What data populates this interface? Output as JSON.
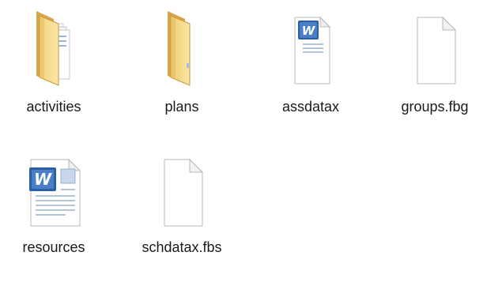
{
  "files": [
    {
      "name": "activities",
      "icon": "folder-with-documents-icon"
    },
    {
      "name": "plans",
      "icon": "folder-icon"
    },
    {
      "name": "assdatax",
      "icon": "word-document-icon"
    },
    {
      "name": "groups.fbg",
      "icon": "blank-file-icon"
    },
    {
      "name": "resources",
      "icon": "word-document-large-icon"
    },
    {
      "name": "schdatax.fbs",
      "icon": "blank-file-icon"
    }
  ],
  "colors": {
    "folder_light": "#f6dc8d",
    "folder_dark": "#d9ac48",
    "word_blue": "#2b5ea8",
    "page_border": "#b8b8b8"
  }
}
